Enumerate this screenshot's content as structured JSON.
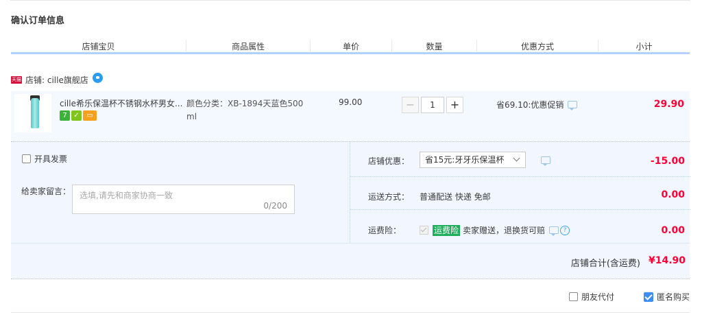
{
  "title": "确认订单信息",
  "table_headers": [
    "店铺宝贝",
    "商品属性",
    "单价",
    "数量",
    "优惠方式",
    "小计"
  ],
  "shop": {
    "logo_text": "天猫",
    "label": "店铺: cille旗舰店",
    "icons": {
      "logo": "tmall-logo",
      "contact": "wangwang-chat-icon"
    }
  },
  "item": {
    "title": "cille希乐保温杯不锈钢水杯男女...",
    "badges": [
      "7",
      "✓",
      "▭"
    ],
    "attributes": "颜色分类：XB-1894天蓝色500 ml",
    "price": "99.00",
    "quantity": "1",
    "qty_minus": "−",
    "qty_plus": "+",
    "promotion": "省69.10:优惠促销",
    "subtotal": "29.90"
  },
  "invoice_label": "开具发票",
  "memo": {
    "label": "给卖家留言：",
    "placeholder": "选填,请先和商家协商一致",
    "counter": "0/200"
  },
  "shop_discount": {
    "label": "店铺优惠：",
    "selected": "省15元:牙牙乐保温杯",
    "value": "-15.00"
  },
  "shipping": {
    "label": "运送方式：",
    "method": "普通配送 快递 免邮",
    "value": "0.00"
  },
  "insurance": {
    "label": "运费险：",
    "tag": "运费险",
    "text": "卖家赠送，退换货可赔",
    "help": "?",
    "value": "0.00"
  },
  "total": {
    "label": "店铺合计(含运费)",
    "value": "¥14.90"
  },
  "friend_pay_label": "朋友代付",
  "anonymous_label": "匿名购买",
  "colors": {
    "accent": "#ff0036",
    "header_border": "#b2d1ff",
    "row_bg": "#f2f7ff",
    "checkbox_on": "#3d8df5"
  }
}
